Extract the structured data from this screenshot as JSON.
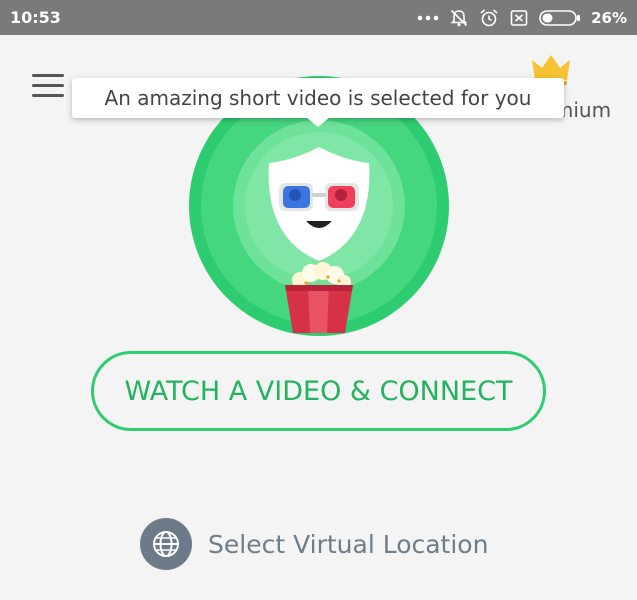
{
  "status_bar": {
    "time": "10:53",
    "battery_percent": "26%",
    "icons": [
      "more-dots-icon",
      "notifications-off-icon",
      "alarm-icon",
      "sim-blocked-icon",
      "battery-icon"
    ]
  },
  "header": {
    "menu_icon": "hamburger-menu-icon",
    "premium_label": "Go Premium",
    "crown_icon": "crown-icon",
    "crown_color": "#f5c332"
  },
  "tooltip": {
    "text": "An amazing short video is selected for you"
  },
  "hero": {
    "mascot_icon": "3d-glasses-shield-mascot-icon",
    "popcorn_icon": "popcorn-bucket-icon",
    "colors": {
      "outer": "#2dcc70",
      "inner": "#6ee69a"
    }
  },
  "actions": {
    "watch_button_label": "WATCH A VIDEO & CONNECT",
    "accent": "#2dcc70"
  },
  "location": {
    "label": "Select Virtual Location",
    "icon": "globe-icon"
  }
}
